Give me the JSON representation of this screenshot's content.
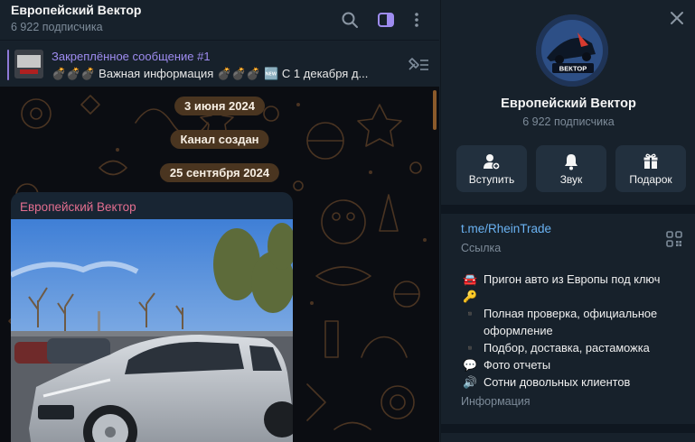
{
  "chat": {
    "title": "Европейский Вектор",
    "subtitle": "6 922 подписчика",
    "pinned": {
      "title": "Закреплённое сообщение #1",
      "text": "💣💣💣 Важная информация 💣💣💣 🆕 С 1 декабря д..."
    },
    "dates": [
      "3 июня 2024",
      "Канал создан",
      "25 сентября 2024"
    ],
    "post": {
      "author": "Европейский Вектор"
    }
  },
  "panel": {
    "name": "Европейский Вектор",
    "subs": "6 922 подписчика",
    "avatar_text": "ВЕКТОР",
    "actions": [
      {
        "label": "Вступить",
        "icon": "join-icon"
      },
      {
        "label": "Звук",
        "icon": "bell-icon"
      },
      {
        "label": "Подарок",
        "icon": "gift-icon"
      }
    ],
    "link": "t.me/RheinTrade",
    "link_caption": "Ссылка",
    "info_lines": [
      {
        "emoji": "🚘",
        "text": "Пригон авто из Европы под ключ"
      },
      {
        "emoji": "🔑",
        "text": ""
      },
      {
        "emoji": "▪️",
        "text": "Полная проверка, официальное оформление"
      },
      {
        "emoji": "▪️",
        "text": "Подбор, доставка, растаможка"
      },
      {
        "emoji": "💬",
        "text": "Фото отчеты"
      },
      {
        "emoji": "🔊",
        "text": "Сотни довольных клиентов"
      }
    ],
    "info_caption": "Информация"
  },
  "colors": {
    "accent": "#9e8cf0",
    "link": "#6ab2f2",
    "author": "#e36e8f",
    "date_chip": "#4a3520"
  }
}
